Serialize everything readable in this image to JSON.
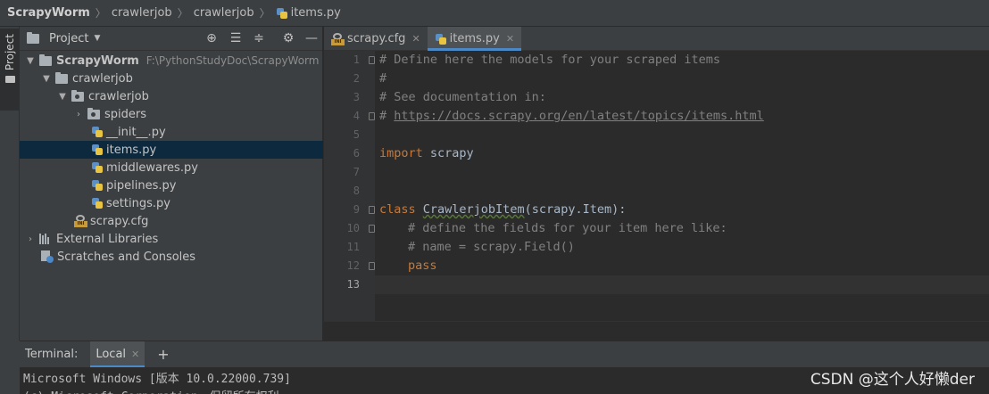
{
  "breadcrumb": [
    "ScrapyWorm",
    "crawlerjob",
    "crawlerjob",
    "items.py"
  ],
  "stripe": {
    "project_label": "Project"
  },
  "project_panel": {
    "title": "Project",
    "tree": [
      {
        "label": "ScrapyWorm",
        "hint": "F:\\PythonStudyDoc\\ScrapyWorm"
      },
      {
        "label": "crawlerjob"
      },
      {
        "label": "crawlerjob"
      },
      {
        "label": "spiders"
      },
      {
        "label": "__init__.py"
      },
      {
        "label": "items.py"
      },
      {
        "label": "middlewares.py"
      },
      {
        "label": "pipelines.py"
      },
      {
        "label": "settings.py"
      },
      {
        "label": "scrapy.cfg"
      },
      {
        "label": "External Libraries"
      },
      {
        "label": "Scratches and Consoles"
      }
    ]
  },
  "tabs": [
    {
      "label": "scrapy.cfg"
    },
    {
      "label": "items.py"
    }
  ],
  "editor": {
    "line_numbers": [
      "1",
      "2",
      "3",
      "4",
      "5",
      "6",
      "7",
      "8",
      "9",
      "10",
      "11",
      "12",
      "13"
    ],
    "lines": {
      "l1": "# Define here the models for your scraped items",
      "l2": "#",
      "l3": "# See documentation in:",
      "l4a": "# ",
      "l4b": "https://docs.scrapy.org/en/latest/topics/items.html",
      "l6a": "import",
      "l6b": " scrapy",
      "l9a": "class",
      "l9b": "CrawlerjobItem",
      "l9c": "(scrapy.Item):",
      "l10": "# define the fields for your item here like:",
      "l11": "# name = scrapy.Field()",
      "l12": "pass"
    }
  },
  "terminal": {
    "label": "Terminal:",
    "tab": "Local",
    "line1": "Microsoft Windows [版本 10.0.22000.739]",
    "line2": "(c) Microsoft Corporation。保留所有权利。"
  },
  "watermark": "CSDN @这个人好懒der",
  "colors": {
    "accent": "#4a88c7",
    "keyword": "#cc7832",
    "comment": "#808080",
    "selection": "#0d293e"
  }
}
